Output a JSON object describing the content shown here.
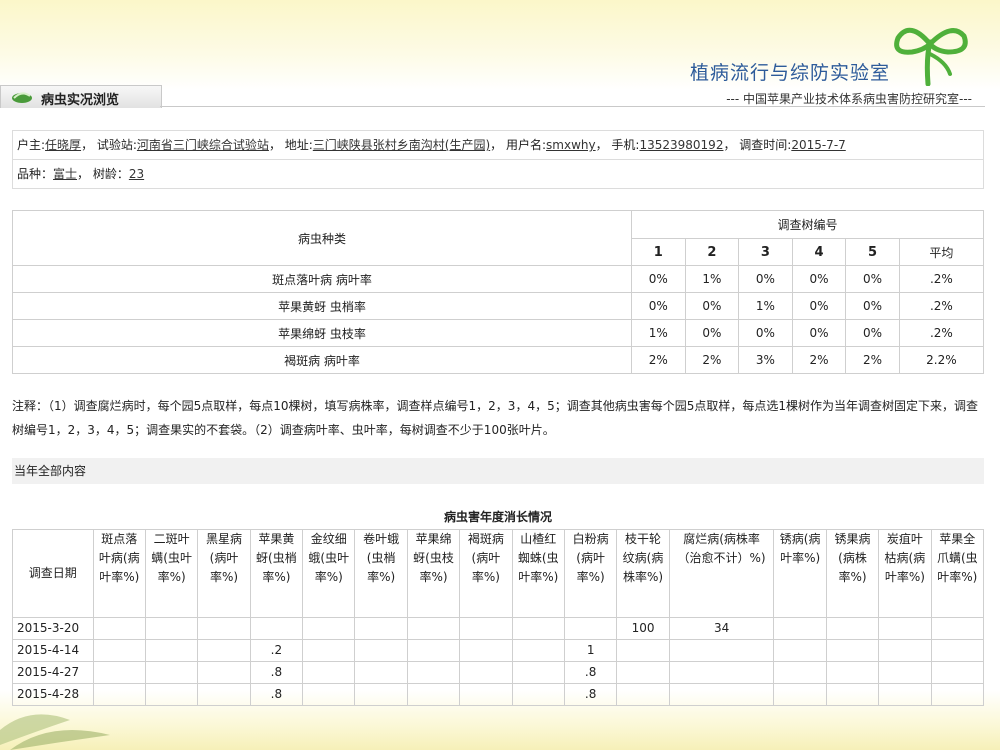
{
  "header": {
    "site_title": "植病流行与综防实验室",
    "page_tab": "病虫实况浏览",
    "credit": "--- 中国苹果产业技术体系病虫害防控研究室---"
  },
  "info": {
    "owner_label": "户主:",
    "owner": "任晓厚",
    "station_label": "， 试验站:",
    "station": "河南省三门峡综合试验站",
    "address_label": "， 地址:",
    "address": "三门峡陕县张村乡南沟村(生产园)",
    "username_label": "， 用户名:",
    "username": "smxwhy",
    "phone_label": "， 手机:",
    "phone": "13523980192",
    "date_label": "， 调查时间:",
    "date": "2015-7-7",
    "variety_label": "品种：",
    "variety": "富士",
    "age_label": "， 树龄：",
    "age": "23"
  },
  "pest_table": {
    "col_label": "病虫种类",
    "tree_label": "调查树编号",
    "trees": [
      "1",
      "2",
      "3",
      "4",
      "5",
      "平均"
    ],
    "rows": [
      {
        "name": "斑点落叶病 病叶率",
        "values": [
          "0%",
          "1%",
          "0%",
          "0%",
          "0%",
          ".2%"
        ]
      },
      {
        "name": "苹果黄蚜 虫梢率",
        "values": [
          "0%",
          "0%",
          "1%",
          "0%",
          "0%",
          ".2%"
        ]
      },
      {
        "name": "苹果绵蚜 虫枝率",
        "values": [
          "1%",
          "0%",
          "0%",
          "0%",
          "0%",
          ".2%"
        ]
      },
      {
        "name": "褐斑病 病叶率",
        "values": [
          "2%",
          "2%",
          "3%",
          "2%",
          "2%",
          "2.2%"
        ]
      }
    ]
  },
  "note": "注释：（1）调查腐烂病时，每个园5点取样，每点10棵树，填写病株率，调查样点编号1，2，3，4，5；调查其他病虫害每个园5点取样，每点选1棵树作为当年调查树固定下来，调查树编号1，2，3，4，5；调查果实的不套袋。（2）调查病叶率、虫叶率，每树调查不少于100张叶片。",
  "section_label": "当年全部内容",
  "season": {
    "title": "病虫害年度消长情况",
    "date_header": "调查日期",
    "headers": [
      "斑点落叶病(病叶率%)",
      "二斑叶螨(虫叶率%)",
      "黑星病(病叶率%)",
      "苹果黄蚜(虫梢率%)",
      "金纹细蛾(虫叶率%)",
      "卷叶蛾(虫梢率%)",
      "苹果绵蚜(虫枝率%)",
      "褐斑病(病叶率%)",
      "山楂红蜘蛛(虫叶率%)",
      "白粉病(病叶率%)",
      "枝干轮纹病(病株率%)",
      "腐烂病(病株率（治愈不计）%)",
      "锈病(病叶率%)",
      "锈果病(病株率%)",
      "炭疽叶枯病(病叶率%)",
      "苹果全爪螨(虫叶率%)"
    ],
    "rows": [
      {
        "date": "2015-3-20",
        "cells": [
          "",
          "",
          "",
          "",
          "",
          "",
          "",
          "",
          "",
          "",
          "100",
          "34",
          "",
          "",
          "",
          ""
        ]
      },
      {
        "date": "2015-4-14",
        "cells": [
          "",
          "",
          "",
          ".2",
          "",
          "",
          "",
          "",
          "",
          "1",
          "",
          "",
          "",
          "",
          "",
          ""
        ]
      },
      {
        "date": "2015-4-27",
        "cells": [
          "",
          "",
          "",
          ".8",
          "",
          "",
          "",
          "",
          "",
          ".8",
          "",
          "",
          "",
          "",
          "",
          ""
        ]
      },
      {
        "date": "2015-4-28",
        "cells": [
          "",
          "",
          "",
          ".8",
          "",
          "",
          "",
          "",
          "",
          ".8",
          "",
          "",
          "",
          "",
          "",
          ""
        ]
      }
    ]
  }
}
